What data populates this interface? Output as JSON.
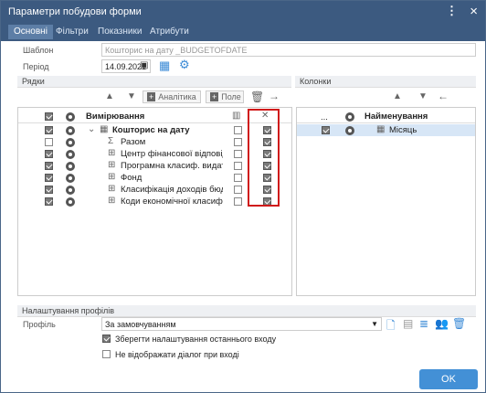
{
  "title": "Параметри побудови форми",
  "menu_icon": "kebab-icon",
  "close_icon": "close-icon",
  "tabs": [
    "Основні",
    "Фільтри",
    "Показники",
    "Атрибути"
  ],
  "template_label": "Шаблон",
  "template_value": "Кошторис на дату _BUDGETOFDATE",
  "period_label": "Період",
  "period_value": "14.09.2021",
  "rows_section": "Рядки",
  "cols_section": "Колонки",
  "analytics_btn": "Аналітика",
  "field_btn": "Поле",
  "rows_header": "Вимірювання",
  "rows": [
    {
      "label": "Кошторис на дату",
      "bold": true,
      "c1": true,
      "c2": true,
      "indent": 0,
      "icon": "table-icon"
    },
    {
      "label": "Разом",
      "bold": false,
      "c1": false,
      "c2": true,
      "indent": 1,
      "icon": "sigma-icon"
    },
    {
      "label": "Центр фінансової відповідальності",
      "bold": false,
      "c1": true,
      "c2": true,
      "indent": 1,
      "icon": "hierarchy-icon"
    },
    {
      "label": "Програмна класиф. видатків",
      "bold": false,
      "c1": true,
      "c2": true,
      "indent": 1,
      "icon": "hierarchy-icon"
    },
    {
      "label": "Фонд",
      "bold": false,
      "c1": true,
      "c2": true,
      "indent": 1,
      "icon": "hierarchy-icon"
    },
    {
      "label": "Класифікація доходів бюджету",
      "bold": false,
      "c1": true,
      "c2": true,
      "indent": 1,
      "icon": "hierarchy-icon"
    },
    {
      "label": "Коди економічної класифікації",
      "bold": false,
      "c1": true,
      "c2": true,
      "indent": 1,
      "icon": "hierarchy-icon"
    }
  ],
  "cols_header": "Найменування",
  "cols_dots": "...",
  "cols": [
    {
      "label": "Місяць",
      "checked": true,
      "icon": "calendar-icon"
    }
  ],
  "profile_section": "Налаштування профілів",
  "profile_label": "Профіль",
  "profile_value": "За замовчуванням",
  "save_last_label": "Зберегти налаштування останнього входу",
  "no_dialog_label": "Не відображати діалог при вході",
  "ok_label": "OK",
  "accent": "#3c5a80",
  "highlight": "#d01a1a"
}
